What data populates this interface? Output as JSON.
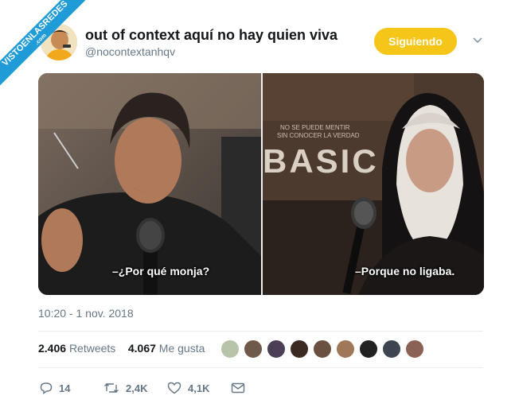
{
  "watermark": {
    "text": "VISTOENLASREDES",
    "sub": ".com"
  },
  "tweet": {
    "author_name": "out of context aquí no hay quien viva",
    "author_handle": "@nocontextanhqv",
    "follow_label": "Siguiendo",
    "subtitle_left": "–¿Por qué monja?",
    "subtitle_right": "–Porque no ligaba.",
    "poster_tagline_1": "NO SE PUEDE MENTIR",
    "poster_tagline_2": "SIN CONOCER LA VERDAD",
    "poster_title": "BASIC",
    "timestamp": "10:20 - 1 nov. 2018",
    "retweets_count": "2.406",
    "retweets_label": "Retweets",
    "likes_count": "4.067",
    "likes_label": "Me gusta",
    "reply_count": "14",
    "retweet_action_count": "2,4K",
    "like_action_count": "4,1K"
  },
  "colors": {
    "follow": "#f5c518",
    "ribbon": "#1f9bd7",
    "muted": "#657786",
    "text": "#14171a"
  }
}
